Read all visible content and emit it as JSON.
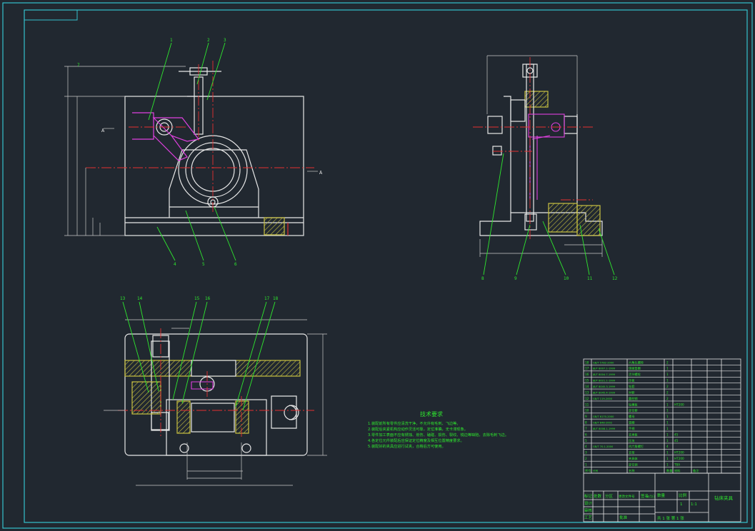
{
  "colors": {
    "background": "#212830",
    "frame": "#35c0cc",
    "outline": "#e8e8e8",
    "leader": "#2ee82e",
    "centerline": "#e53030",
    "highlight": "#e040e0",
    "hatch": "#c8c040",
    "dimension": "#c8c8c8"
  },
  "views": {
    "front": {
      "balloons": [
        "1",
        "2",
        "3",
        "4",
        "5",
        "6",
        "7"
      ],
      "section_marks": [
        "A",
        "A",
        "B",
        "B"
      ]
    },
    "side": {
      "balloons": [
        "8",
        "9",
        "10",
        "11",
        "12"
      ]
    },
    "top": {
      "balloons": [
        "13",
        "14",
        "15",
        "16",
        "17",
        "18"
      ]
    }
  },
  "technical_requirements": {
    "title": "技术要求",
    "lines": [
      "1.装配前所有零件应清洗干净，不允许有毛刺、飞边等。",
      "2.装配后夹紧机构应动作灵活可靠，定位准确，无卡滞现象。",
      "3.零件加工表面不应有锈蚀、划伤、磕碰、损伤、裂纹、锐边等缺陷，去除毛刺飞边。",
      "4.各定位元件装配后应保证定位精度及相互位置精度要求。",
      "5.装配好的夹具应进行试夹，合格后方可使用。"
    ]
  },
  "bom": {
    "rows": [
      [
        "18",
        "GB/T 5782-2000",
        "六角头螺栓",
        "2",
        "",
        ""
      ],
      [
        "17",
        "JB/T 8007.1-1999",
        "球面垫圈",
        "1",
        "",
        ""
      ],
      [
        "16",
        "JB/T 8004.7-1999",
        "活节螺栓",
        "1",
        "",
        ""
      ],
      [
        "15",
        "JB/T 8021.1-1999",
        "压板",
        "1",
        "",
        ""
      ],
      [
        "14",
        "JB/T 8045.3-1999",
        "钻套",
        "2",
        "",
        ""
      ],
      [
        "13",
        "JB/T 8045.4-1999",
        "衬套",
        "2",
        "",
        ""
      ],
      [
        "12",
        "GB/T 119-2000",
        "圆柱销",
        "2",
        "",
        ""
      ],
      [
        "11",
        "",
        "钻模板",
        "1",
        "HT200",
        ""
      ],
      [
        "10",
        "",
        "定位套",
        "1",
        "",
        ""
      ],
      [
        "9",
        "GB/T 6170-2000",
        "螺母",
        "1",
        "",
        ""
      ],
      [
        "8",
        "GB/T 848-2002",
        "垫圈",
        "1",
        "",
        ""
      ],
      [
        "7",
        "JB/T 8008.1-1999",
        "手柄",
        "1",
        "",
        ""
      ],
      [
        "6",
        "",
        "支承板",
        "1",
        "45",
        ""
      ],
      [
        "5",
        "",
        "压块",
        "1",
        "45",
        ""
      ],
      [
        "4",
        "GB/T 70.1-2000",
        "内六角螺钉",
        "4",
        "",
        ""
      ],
      [
        "3",
        "",
        "支架",
        "1",
        "HT200",
        ""
      ],
      [
        "2",
        "",
        "夹具体",
        "1",
        "HT200",
        ""
      ],
      [
        "1",
        "",
        "定位销",
        "1",
        "T8A",
        ""
      ]
    ],
    "header": [
      "序号",
      "代号",
      "名称",
      "数量",
      "材料",
      "备注"
    ]
  },
  "title_block": {
    "drawing_name": "钻床夹具",
    "scale_label": "比例",
    "scale": "1:1",
    "quantity_label": "数量",
    "quantity": "1",
    "sheet_label": "共 1 张 第 1 张",
    "rows": [
      "标记",
      "处数",
      "分区",
      "更改文件号",
      "签名",
      "年月日"
    ],
    "roles": [
      "设计",
      "审核",
      "工艺",
      "批准"
    ]
  }
}
